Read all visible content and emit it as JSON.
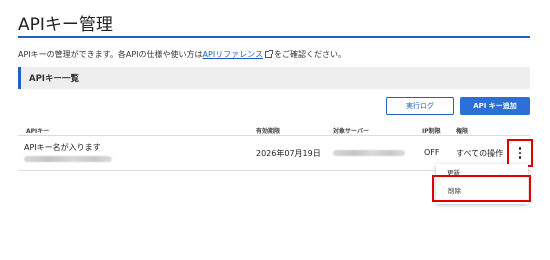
{
  "page": {
    "title": "APIキー管理",
    "description": {
      "before": "APIキーの管理ができます。各APIの仕様や使い方は",
      "link": "APIリファレンス",
      "after": "をご確認ください。"
    }
  },
  "section": {
    "title": "APIキー一覧"
  },
  "toolbar": {
    "log_label": "実行ログ",
    "add_label": "API キー追加"
  },
  "table": {
    "headers": {
      "api_key": "APIキー",
      "expiry": "有効期限",
      "target_server": "対象サーバー",
      "ip_limit": "IP制限",
      "permission": "権限"
    },
    "rows": [
      {
        "name": "APIキー名が入ります",
        "expiry": "2026年07月19日",
        "ip_limit": "OFF",
        "permission": "すべての操作"
      }
    ]
  },
  "menu": {
    "update_label": "更新",
    "delete_label": "削除"
  },
  "colors": {
    "accent": "#1e62c9",
    "highlight": "#e00000",
    "section_bg": "#eeeeee"
  },
  "icons": {
    "external_link": "external-link-icon",
    "more": "more-vertical-icon"
  }
}
